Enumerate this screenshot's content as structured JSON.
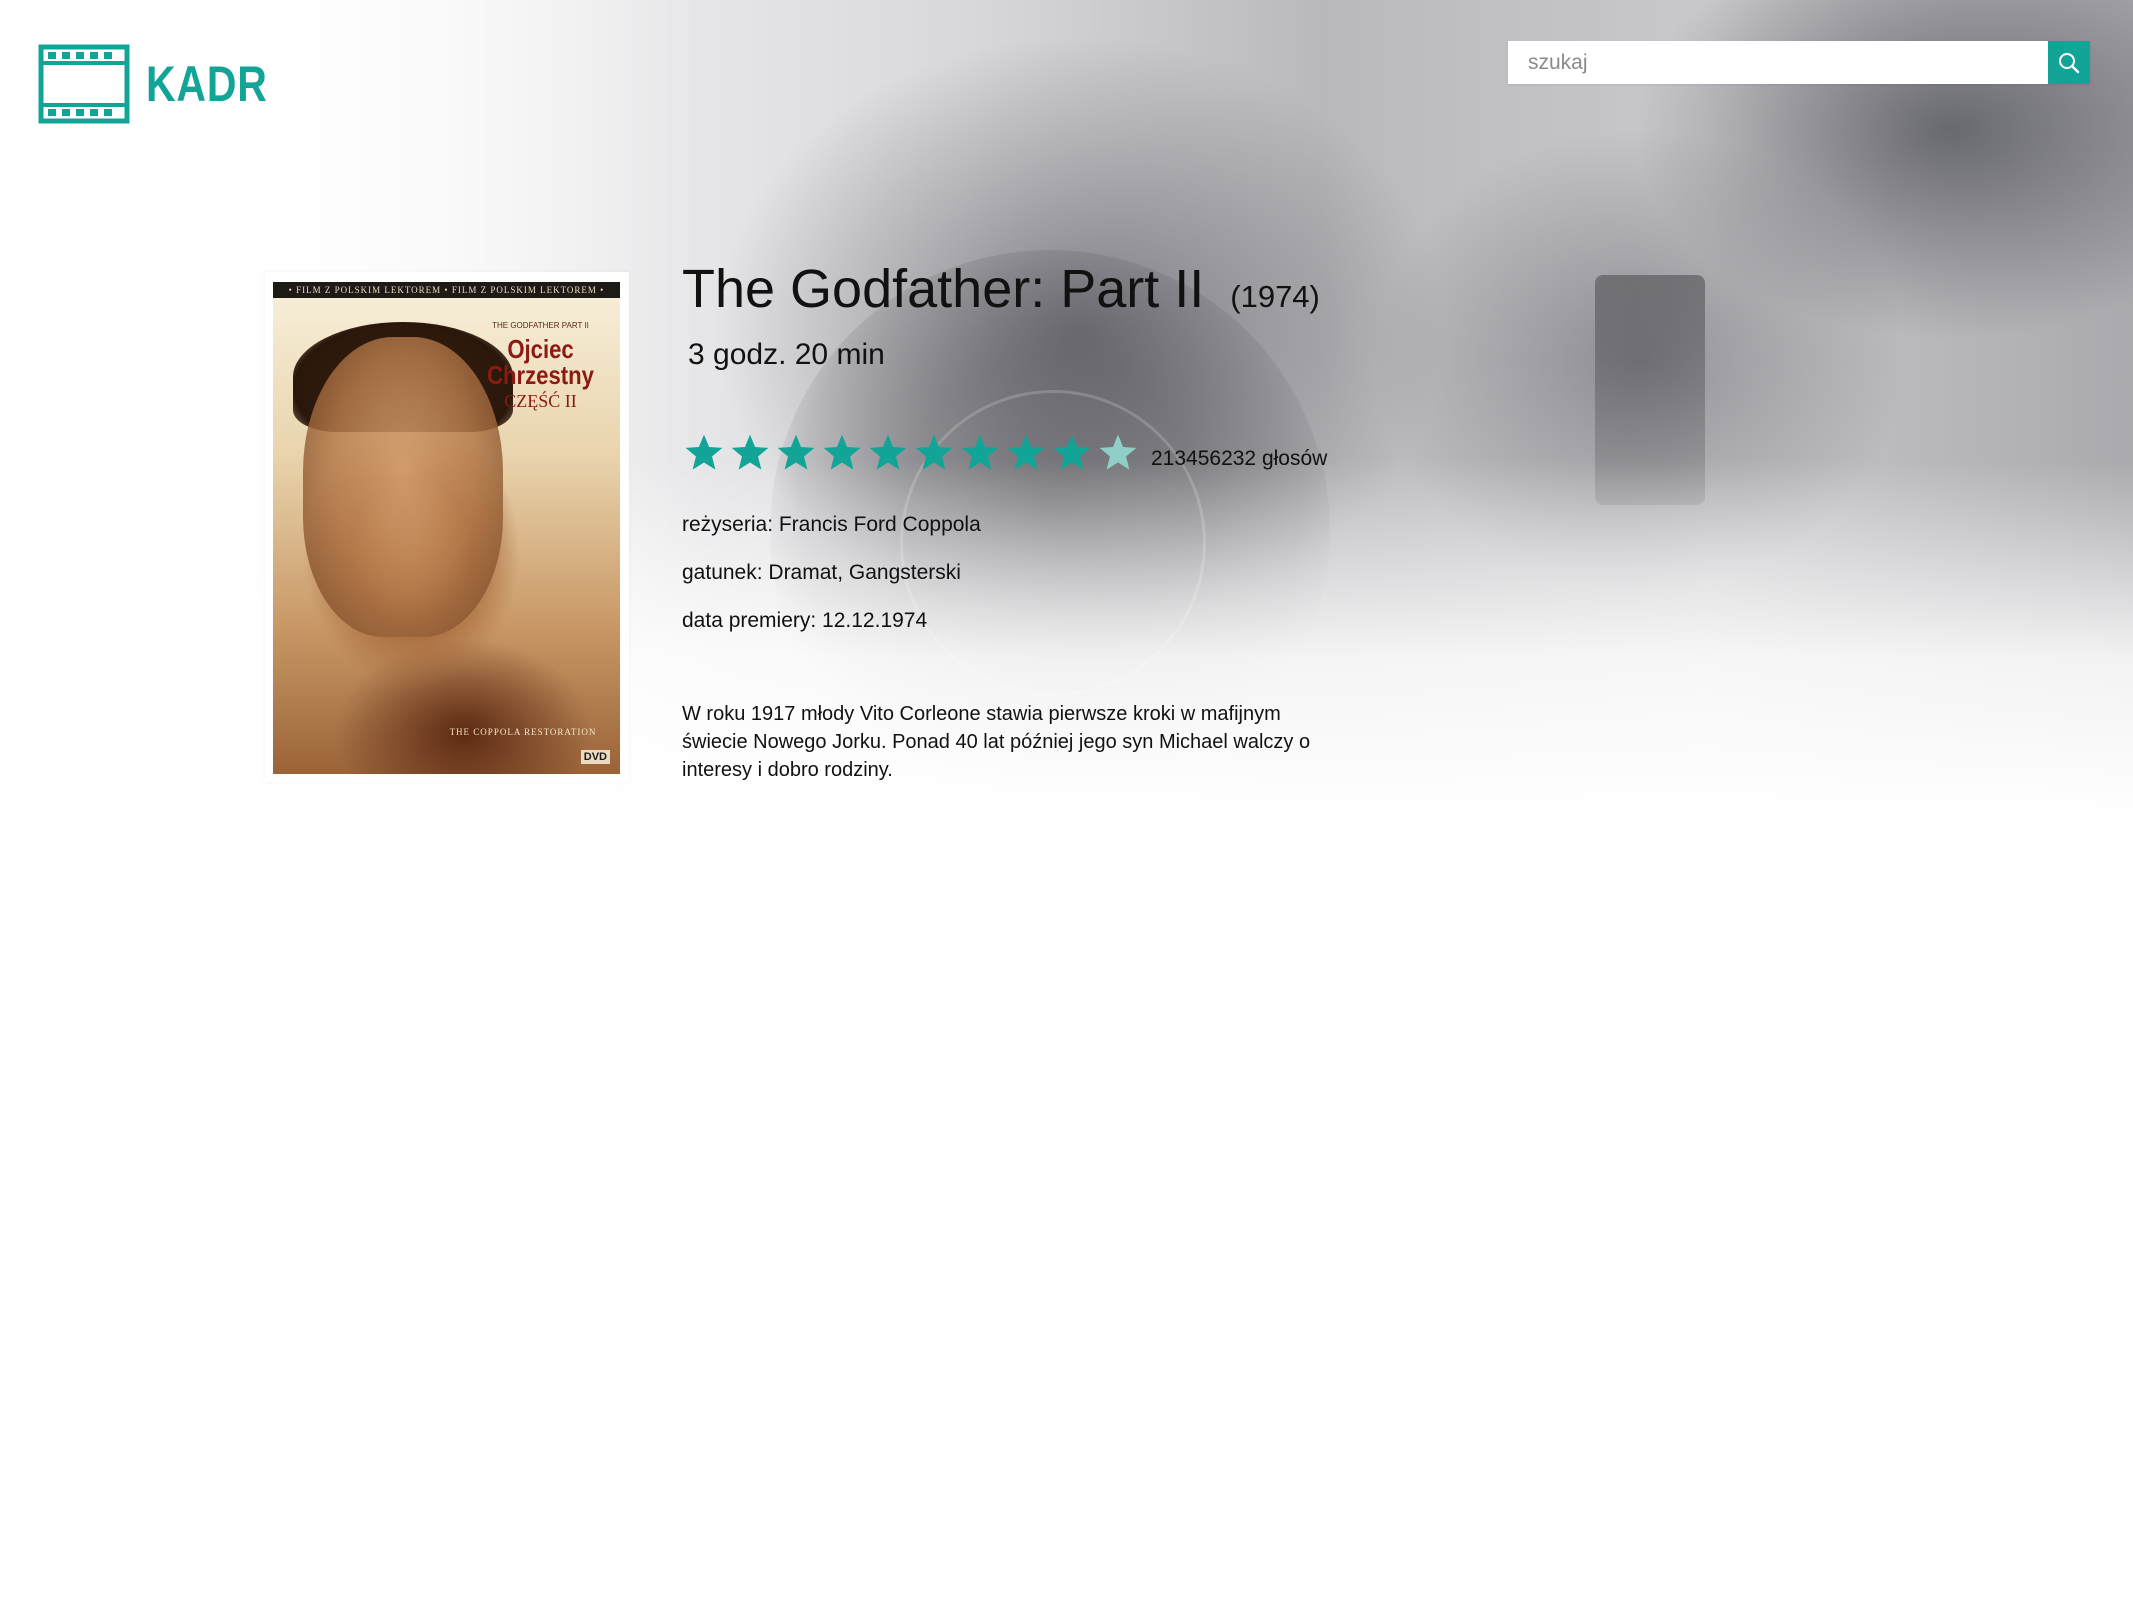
{
  "brand": {
    "name": "KADR",
    "accent_color": "#12a597",
    "logo_icon": "film-strip-icon"
  },
  "search": {
    "placeholder": "szukaj",
    "value": "",
    "button_icon": "search-icon"
  },
  "movie": {
    "title": "The Godfather: Part II",
    "year": "(1974)",
    "duration": "3 godz. 20 min",
    "rating": {
      "filled_stars": 9,
      "max_stars": 10,
      "filled_color": "#12a597",
      "empty_color": "#8fcfc8",
      "votes": "213456232 głosów"
    },
    "director": "reżyseria: Francis Ford Coppola",
    "genre": "gatunek: Dramat, Gangsterski",
    "premiere": "data premiery: 12.12.1974",
    "description": "W roku 1917 młody Vito Corleone stawia pierwsze kroki w mafijnym świecie Nowego Jorku. Ponad 40 lat później jego syn Michael walczy o interesy i dobro rodziny.",
    "poster": {
      "banner": "• FILM Z POLSKIM LEKTOREM • FILM Z POLSKIM LEKTOREM •",
      "small_title": "THE GODFATHER PART II",
      "title": "Ojciec Chrzestny",
      "part": "CZĘŚĆ II",
      "restoration": "THE COPPOLA RESTORATION",
      "dvd": "DVD"
    }
  }
}
